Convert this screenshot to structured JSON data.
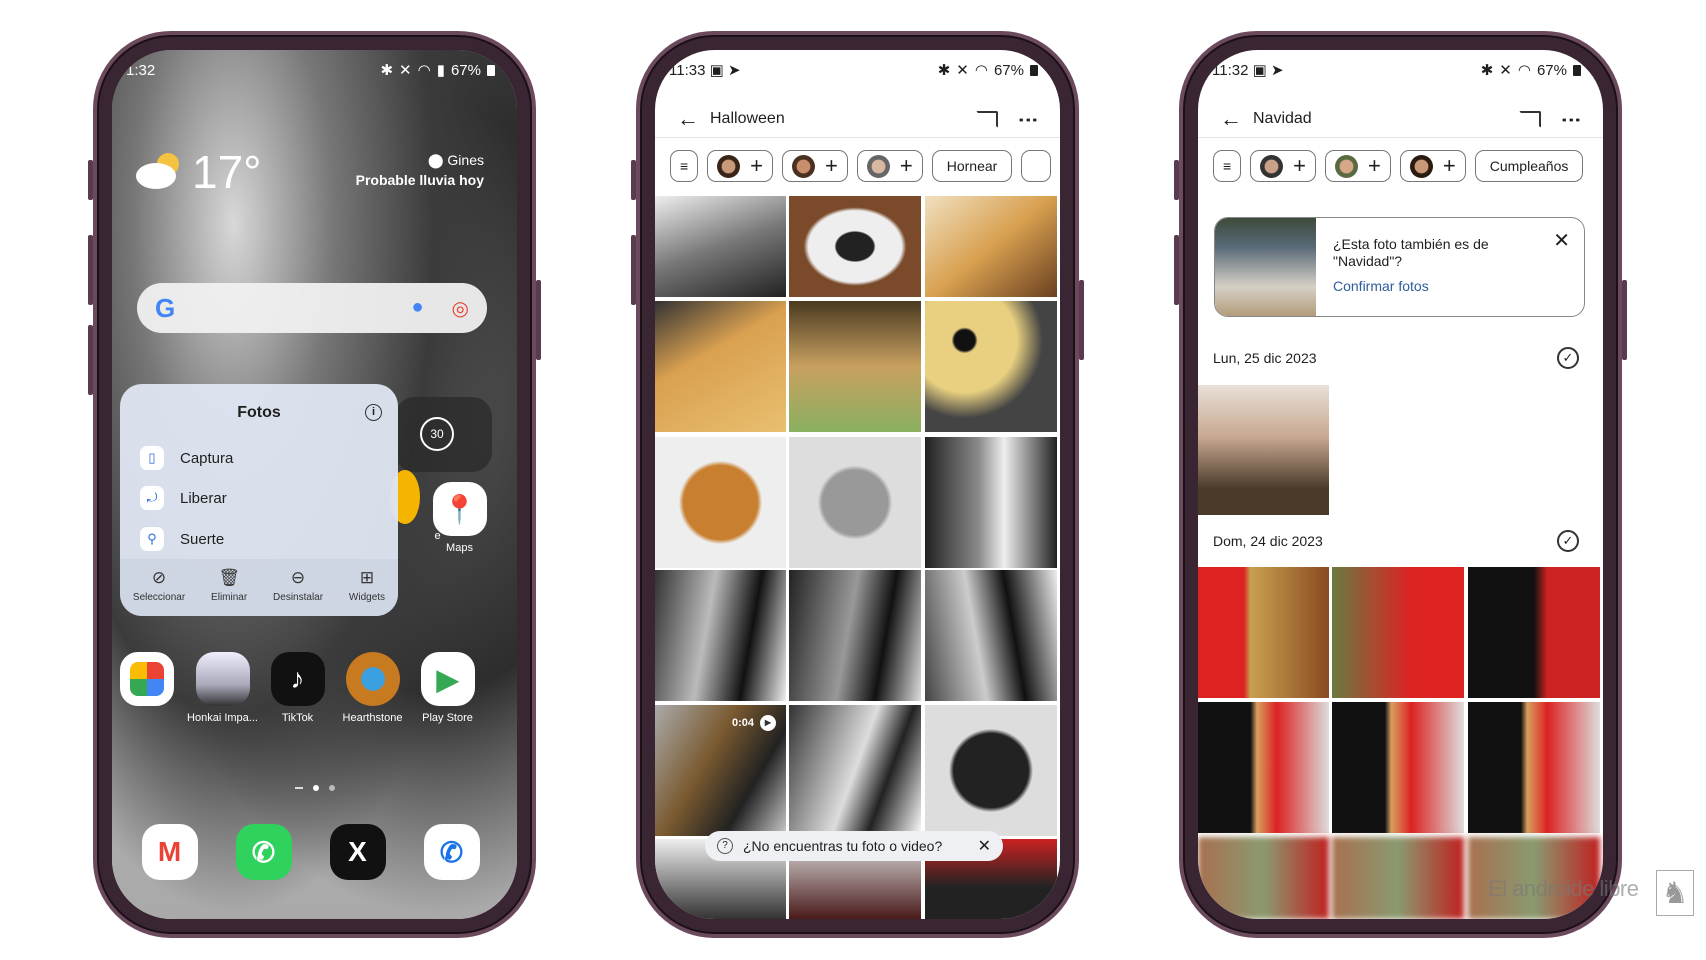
{
  "home": {
    "status": {
      "time": "1:32",
      "battery": "67%"
    },
    "weather": {
      "temp": "17°",
      "location": "Gines",
      "forecast": "Probable lluvia hoy",
      "icon": "partly-cloudy-icon"
    },
    "media_widget": {
      "label": "30",
      "icon": "replay-30-icon"
    },
    "popup": {
      "title": "Fotos",
      "shortcuts": [
        {
          "label": "Captura",
          "icon": "phone-icon"
        },
        {
          "label": "Liberar",
          "icon": "free-up-space-icon"
        },
        {
          "label": "Suerte",
          "icon": "search-icon"
        }
      ],
      "actions": [
        {
          "label": "Seleccionar",
          "icon": "check-circle-icon"
        },
        {
          "label": "Eliminar",
          "icon": "trash-icon"
        },
        {
          "label": "Desinstalar",
          "icon": "minus-circle-icon"
        },
        {
          "label": "Widgets",
          "icon": "widgets-icon"
        }
      ]
    },
    "partial_app_label": "e",
    "maps_label": "Maps",
    "apps": [
      {
        "label": "",
        "icon": "google-photos-icon"
      },
      {
        "label": "Honkai Impa...",
        "icon": "honkai-icon"
      },
      {
        "label": "TikTok",
        "icon": "tiktok-icon"
      },
      {
        "label": "Hearthstone",
        "icon": "hearthstone-icon"
      },
      {
        "label": "Play Store",
        "icon": "play-store-icon"
      }
    ],
    "dock": [
      {
        "icon": "gmail-icon"
      },
      {
        "icon": "whatsapp-icon"
      },
      {
        "icon": "x-icon"
      },
      {
        "icon": "phone-call-icon"
      }
    ]
  },
  "halloween": {
    "status": {
      "time": "11:33",
      "battery": "67%"
    },
    "title": "Halloween",
    "chips": [
      "Hornear"
    ],
    "video_duration": "0:04",
    "pill_text": "¿No encuentras tu foto o video?"
  },
  "navidad": {
    "status": {
      "time": "11:32",
      "battery": "67%"
    },
    "title": "Navidad",
    "chips": [
      "Cumpleaños"
    ],
    "card": {
      "question": "¿Esta foto también es de \"Navidad\"?",
      "link": "Confirmar fotos"
    },
    "dates": [
      "Lun, 25 dic 2023",
      "Dom, 24 dic 2023"
    ]
  },
  "watermark": "El androide libre",
  "colors": {
    "frame": "#3a2633",
    "link": "#2f5c9a"
  }
}
